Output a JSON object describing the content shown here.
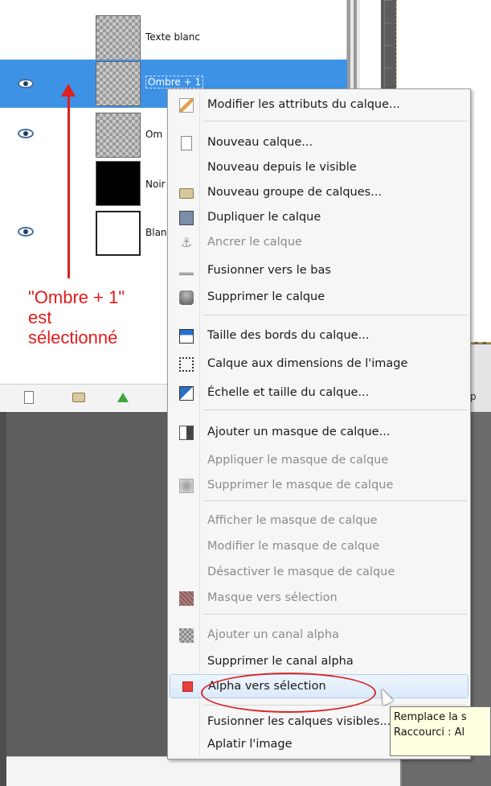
{
  "layers": [
    {
      "name": "Texte blanc",
      "visible": false,
      "thumb": "checker",
      "selected": false
    },
    {
      "name": "Ombre + 1",
      "visible": true,
      "thumb": "checker",
      "selected": true
    },
    {
      "name": "Om",
      "visible": true,
      "thumb": "checker",
      "selected": false
    },
    {
      "name": "Noir",
      "visible": false,
      "thumb": "black",
      "selected": false
    },
    {
      "name": "Blan",
      "visible": true,
      "thumb": "white",
      "selected": false
    }
  ],
  "annotation": {
    "text": "\"Ombre + 1\"\nest\nsélectionné",
    "color": "#e01c1c"
  },
  "toolbar": {
    "partial_label": "p"
  },
  "menu": {
    "items": [
      {
        "label": "Modifier les attributs du calque...",
        "icon": "edit-icon",
        "disabled": false
      },
      {
        "label": "Nouveau calque...",
        "icon": "new-layer-icon",
        "disabled": false
      },
      {
        "label": "Nouveau depuis le visible",
        "icon": "",
        "disabled": false
      },
      {
        "label": "Nouveau groupe de calques...",
        "icon": "folder-icon",
        "disabled": false
      },
      {
        "label": "Dupliquer le calque",
        "icon": "duplicate-icon",
        "disabled": false
      },
      {
        "label": "Ancrer le calque",
        "icon": "anchor-icon",
        "disabled": true
      },
      {
        "label": "Fusionner vers le bas",
        "icon": "merge-down-icon",
        "disabled": false
      },
      {
        "label": "Supprimer le calque",
        "icon": "delete-icon",
        "disabled": false
      },
      {
        "label": "Taille des bords du calque...",
        "icon": "layer-boundary-icon",
        "disabled": false
      },
      {
        "label": "Calque aux dimensions de l'image",
        "icon": "fit-image-icon",
        "disabled": false
      },
      {
        "label": "Échelle et taille du calque...",
        "icon": "scale-icon",
        "disabled": false
      },
      {
        "label": "Ajouter un masque de calque...",
        "icon": "add-mask-icon",
        "disabled": false
      },
      {
        "label": "Appliquer le masque de calque",
        "icon": "",
        "disabled": true
      },
      {
        "label": "Supprimer le masque de calque",
        "icon": "delete-mask-icon",
        "disabled": true
      },
      {
        "label": "Afficher le masque de calque",
        "icon": "",
        "disabled": true
      },
      {
        "label": "Modifier le masque de calque",
        "icon": "",
        "disabled": true
      },
      {
        "label": "Désactiver le masque de calque",
        "icon": "",
        "disabled": true
      },
      {
        "label": "Masque vers sélection",
        "icon": "mask-to-selection-icon",
        "disabled": true
      },
      {
        "label": "Ajouter un canal alpha",
        "icon": "alpha-channel-icon",
        "disabled": true
      },
      {
        "label": "Supprimer le canal alpha",
        "icon": "",
        "disabled": false
      },
      {
        "label": "Alpha vers sélection",
        "icon": "alpha-to-selection-icon",
        "disabled": false,
        "highlighted": true
      },
      {
        "label": "Fusionner les calques visibles...",
        "icon": "",
        "disabled": false
      },
      {
        "label": "Aplatir l'image",
        "icon": "",
        "disabled": false
      }
    ]
  },
  "tooltip": {
    "line1": "Remplace la s",
    "line2": "Raccourci : Al"
  }
}
